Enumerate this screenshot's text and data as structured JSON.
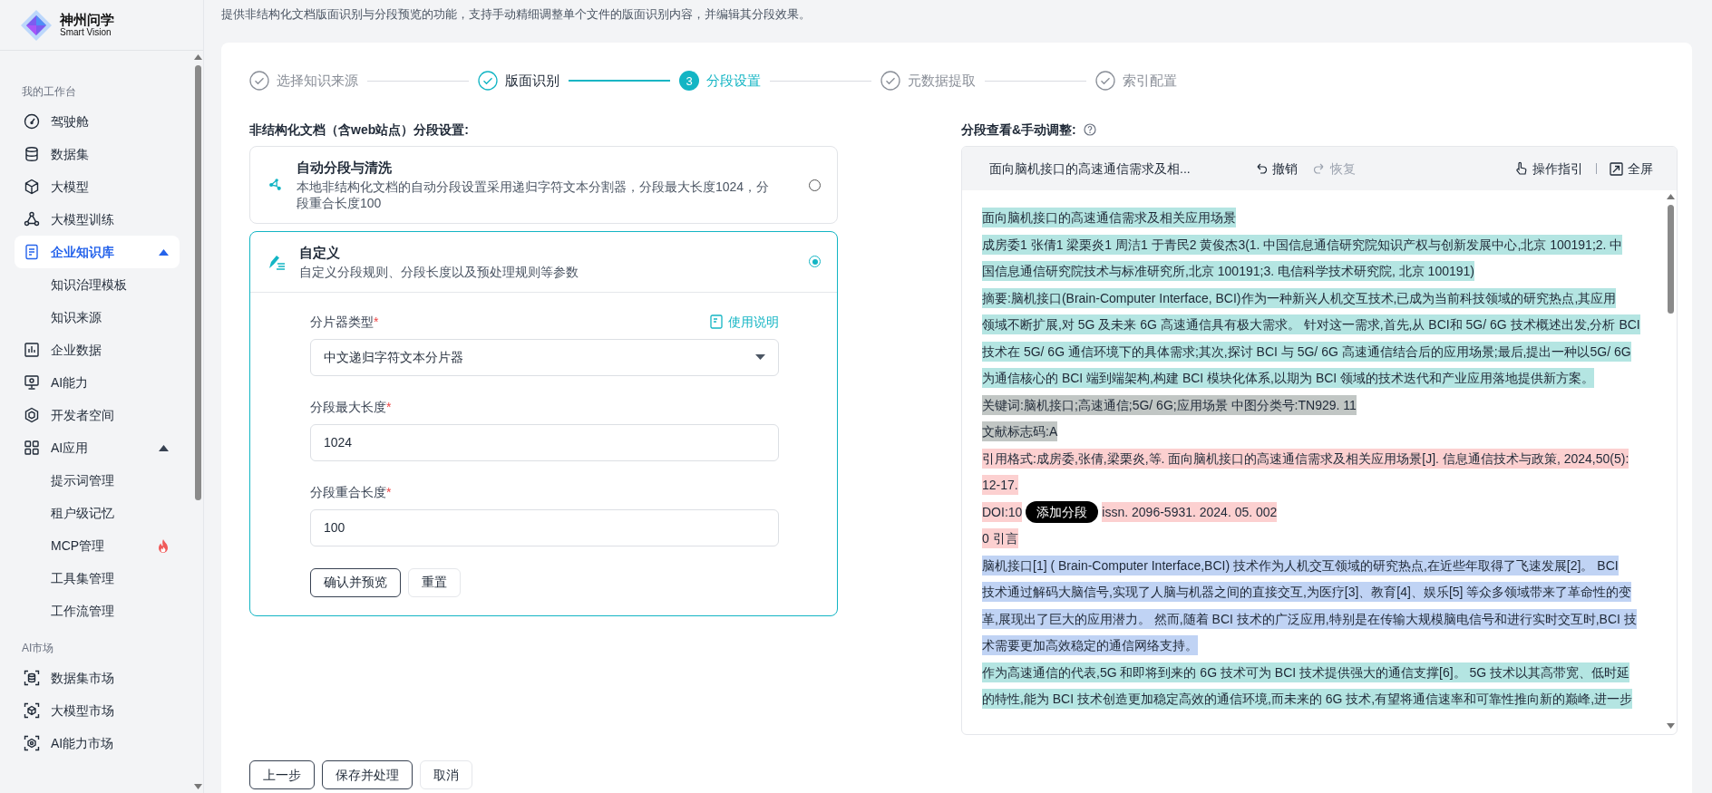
{
  "brand": {
    "name": "神州问学",
    "tagline": "Smart Vision"
  },
  "sidebar": {
    "sections": [
      {
        "title": "我的工作台",
        "items": [
          {
            "label": "驾驶舱",
            "selected": false
          },
          {
            "label": "数据集",
            "selected": false
          },
          {
            "label": "大模型",
            "selected": false
          },
          {
            "label": "大模型训练",
            "selected": false
          },
          {
            "label": "企业知识库",
            "selected": true,
            "expanded": true,
            "children": [
              {
                "label": "知识治理模板",
                "selected": false,
                "hot": false
              },
              {
                "label": "知识来源",
                "selected": false,
                "hot": false
              }
            ]
          },
          {
            "label": "企业数据",
            "selected": false
          },
          {
            "label": "AI能力",
            "selected": false
          },
          {
            "label": "开发者空间",
            "selected": false
          },
          {
            "label": "AI应用",
            "selected": false,
            "expanded": true,
            "children": [
              {
                "label": "提示词管理",
                "selected": false,
                "hot": false
              },
              {
                "label": "租户级记忆",
                "selected": false,
                "hot": false
              },
              {
                "label": "MCP管理",
                "selected": false,
                "hot": true
              },
              {
                "label": "工具集管理",
                "selected": false,
                "hot": false
              },
              {
                "label": "工作流管理",
                "selected": false,
                "hot": false
              }
            ]
          }
        ]
      },
      {
        "title": "AI市场",
        "items": [
          {
            "label": "数据集市场",
            "selected": false
          },
          {
            "label": "大模型市场",
            "selected": false
          },
          {
            "label": "AI能力市场",
            "selected": false
          }
        ]
      }
    ]
  },
  "intro": "提供非结构化文档版面识别与分段预览的功能，支持手动精细调整单个文件的版面识别内容，并编辑其分段效果。",
  "steps": [
    {
      "label": "选择知识来源",
      "kind": "check",
      "selected": false,
      "highlighted": false
    },
    {
      "label": "版面识别",
      "kind": "check",
      "selected": false,
      "highlighted": true
    },
    {
      "label": "分段设置",
      "kind": "number",
      "number": "3",
      "selected": true,
      "highlighted": true
    },
    {
      "label": "元数据提取",
      "kind": "check",
      "selected": false,
      "highlighted": false
    },
    {
      "label": "索引配置",
      "kind": "check",
      "selected": false,
      "highlighted": false
    }
  ],
  "settings": {
    "title": "非结构化文档（含web站点）分段设置:",
    "options": [
      {
        "title": "自动分段与清洗",
        "desc": "本地非结构化文档的自动分段设置采用递归字符文本分割器，分段最大长度1024，分段重合长度100",
        "selected": false
      },
      {
        "title": "自定义",
        "desc": "自定义分段规则、分段长度以及预处理规则等参数",
        "selected": true,
        "fields": [
          {
            "kind": "select",
            "label": "分片器类型",
            "required_mark": "*",
            "help": "使用说明",
            "value": "中文递归字符文本分片器"
          },
          {
            "kind": "input",
            "label": "分段最大长度",
            "required_mark": "*",
            "value": "1024"
          },
          {
            "kind": "input",
            "label": "分段重合长度",
            "required_mark": "*",
            "value": "100"
          }
        ],
        "actions": [
          {
            "label": "确认并预览",
            "kind": "outline"
          },
          {
            "label": "重置",
            "kind": "plain"
          }
        ]
      }
    ]
  },
  "preview": {
    "title": "分段查看&手动调整:",
    "doc_title": "面向脑机接口的高速通信需求及相...",
    "undo": {
      "label": "撤销",
      "disabled": false
    },
    "redo": {
      "label": "恢复",
      "disabled": true
    },
    "guide": "操作指引",
    "fullscreen": "全屏",
    "segments": [
      {
        "lines": [
          "面向脑机接口的高速通信需求及相关应用场景"
        ],
        "color": "#b4e5e2"
      },
      {
        "lines": [
          "成房委1 张倩1 梁栗炎1 周洁1 于青民2 黄俊杰3(1. 中国信息通信研究院知识产权与创新发展中心,北京 100191;2. 中",
          "国信息通信研究院技术与标准研究所,北京 100191;3. 电信科学技术研究院, 北京 100191)"
        ],
        "color": "#b4e5e2"
      },
      {
        "lines": [
          "摘要:脑机接口(Brain-Computer Interface, BCI)作为一种新兴人机交互技术,已成为当前科技领域的研究热点,其应用",
          "领域不断扩展,对 5G 及未来 6G 高速通信具有极大需求。 针对这一需求,首先,从 BCI和 5G/ 6G 技术概述出发,分析 BCI",
          "技术在 5G/ 6G 通信环境下的具体需求;其次,探讨 BCI 与 5G/ 6G 高速通信结合后的应用场景;最后,提出一种以5G/ 6G",
          "为通信核心的 BCI 端到端架构,构建 BCI 模块化体系,以期为 BCI 领域的技术迭代和产业应用落地提供新方案。"
        ],
        "color": "#b4e5e2"
      },
      {
        "lines": [
          "关键词:脑机接口;高速通信;5G/ 6G;应用场景 中图分类号:TN929. 11"
        ],
        "color": "#c1c6c4"
      },
      {
        "lines": [
          "文献标志码:A"
        ],
        "color": "#c1c6c4"
      },
      {
        "lines": [
          "引用格式:成房委,张倩,梁栗炎,等. 面向脑机接口的高速通信需求及相关应用场景[J]. 信息通信技术与政策, 2024,50(5):",
          "12-17."
        ],
        "color": "#fcd0d0"
      },
      {
        "lines": [
          "DOI:10"
        ],
        "tooltip": "添加分段",
        "text_after": "issn. 2096-5931. 2024. 05. 002",
        "color": "#fcd0d0"
      },
      {
        "lines": [
          "0 引言"
        ],
        "color": "#fcd0d0"
      },
      {
        "lines": [
          "脑机接口[1] ( Brain-Computer Interface,BCI) 技术作为人机交互领域的研究热点,在近些年取得了飞速发展[2]。 BCI",
          "技术通过解码大脑信号,实现了人脑与机器之间的直接交互,为医疗[3]、教育[4]、娱乐[5] 等众多领域带来了革命性的变",
          "革,展现出了巨大的应用潜力。 然而,随着 BCI 技术的广泛应用,特别是在传输大规模脑电信号和进行实时交互时,BCI 技",
          "术需要更加高效稳定的通信网络支持。"
        ],
        "color": "#c0d3f4"
      },
      {
        "lines": [
          "作为高速通信的代表,5G 和即将到来的 6G 技术可为 BCI 技术提供强大的通信支撑[6]。 5G 技术以其高带宽、低时延",
          "的特性,能为 BCI 技术创造更加稳定高效的通信环境,而未来的 6G 技术,有望将通信速率和可靠性推向新的巅峰,进一步"
        ],
        "color": "#b4e5e2"
      }
    ]
  },
  "footer_actions": [
    {
      "label": "上一步",
      "kind": "outline"
    },
    {
      "label": "保存并处理",
      "kind": "outline"
    },
    {
      "label": "取消",
      "kind": "plain"
    }
  ]
}
